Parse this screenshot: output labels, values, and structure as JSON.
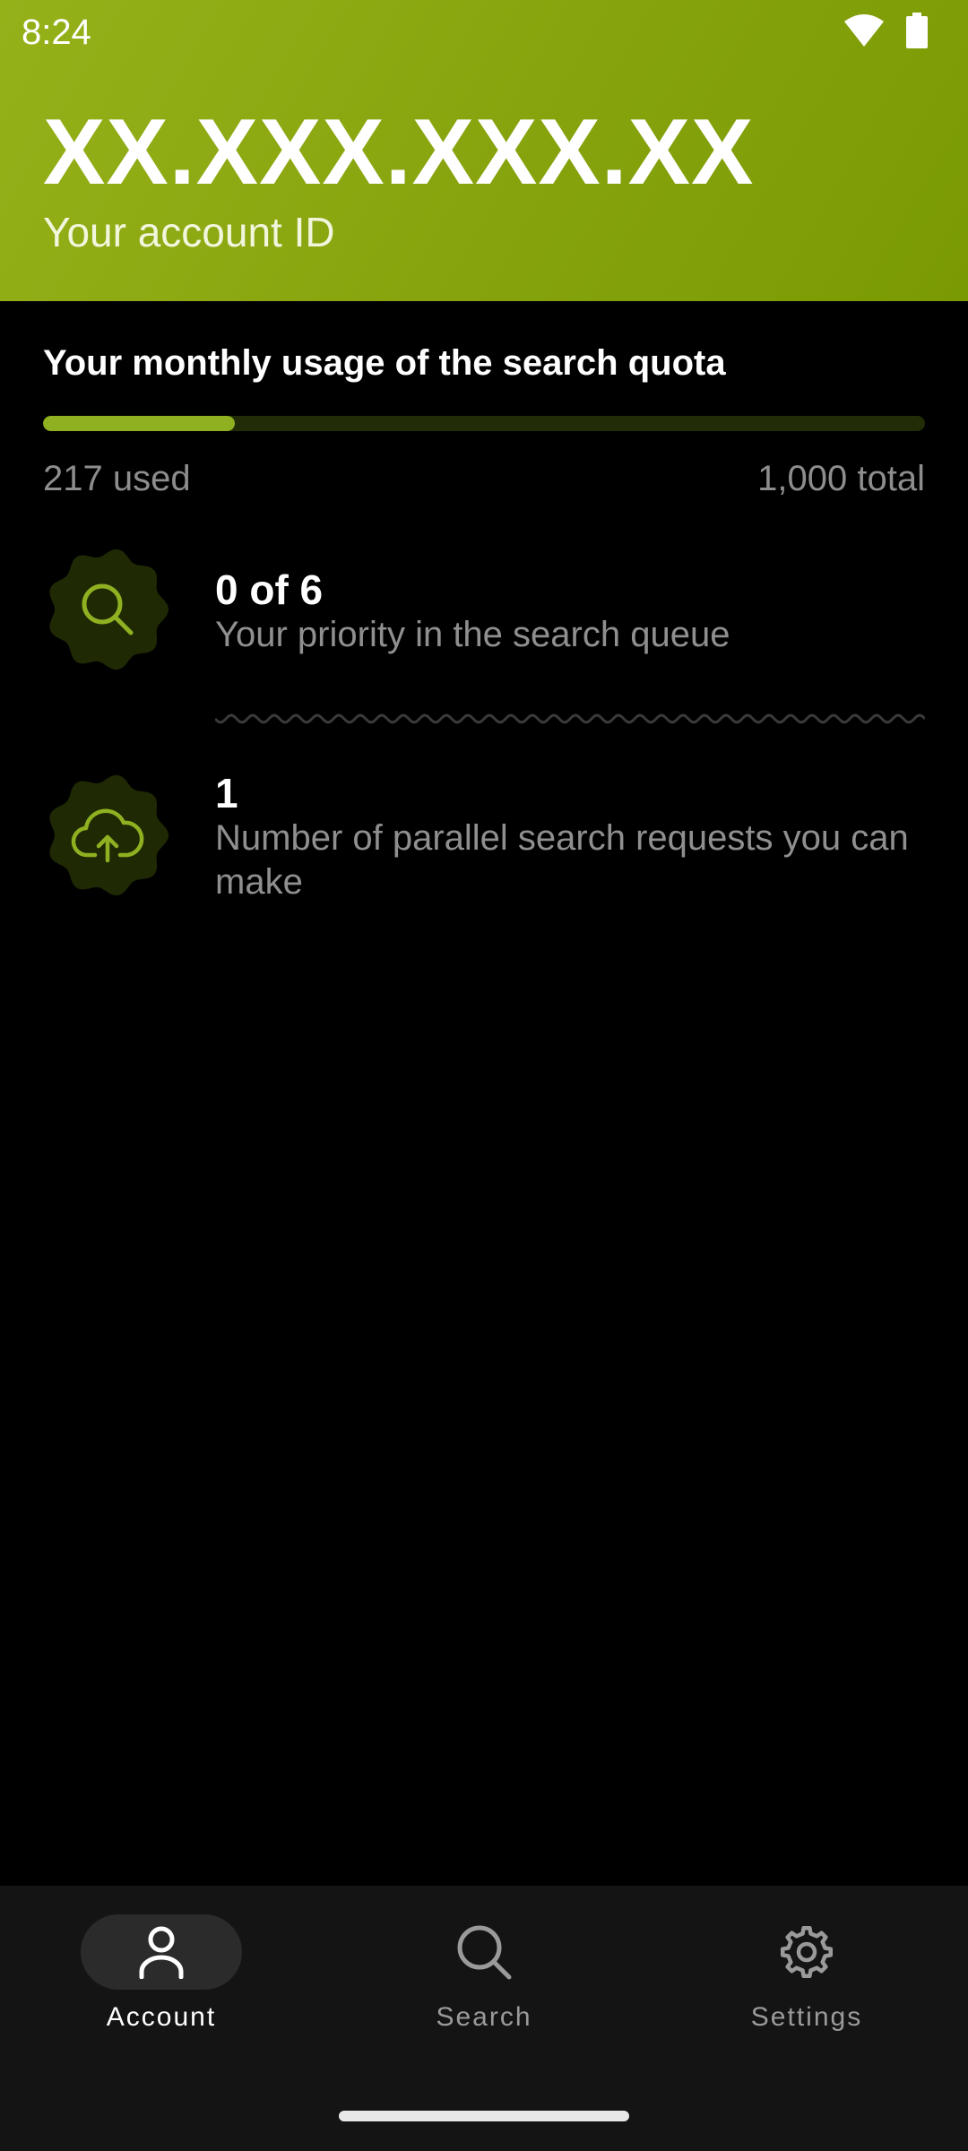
{
  "status_bar": {
    "time": "8:24"
  },
  "header": {
    "account_id": "XX.XXX.XXX.XX",
    "caption": "Your account ID"
  },
  "quota": {
    "title": "Your monthly usage of the search quota",
    "used_label": "217 used",
    "total_label": "1,000 total",
    "used": 217,
    "total": 1000
  },
  "rows": [
    {
      "icon": "search-icon",
      "value": "0 of 6",
      "description": "Your priority in the search queue"
    },
    {
      "icon": "cloud-upload-icon",
      "value": "1",
      "description": "Number of parallel search requests you can make"
    }
  ],
  "nav": {
    "items": [
      {
        "label": "Account",
        "icon": "person-icon",
        "active": true
      },
      {
        "label": "Search",
        "icon": "search-icon",
        "active": false
      },
      {
        "label": "Settings",
        "icon": "gear-icon",
        "active": false
      }
    ]
  },
  "colors": {
    "accent": "#8fb020",
    "header_start": "#95b11a",
    "header_end": "#7a9a04",
    "badge_bg": "#1f2a05",
    "muted_text": "#8f8f8f"
  }
}
